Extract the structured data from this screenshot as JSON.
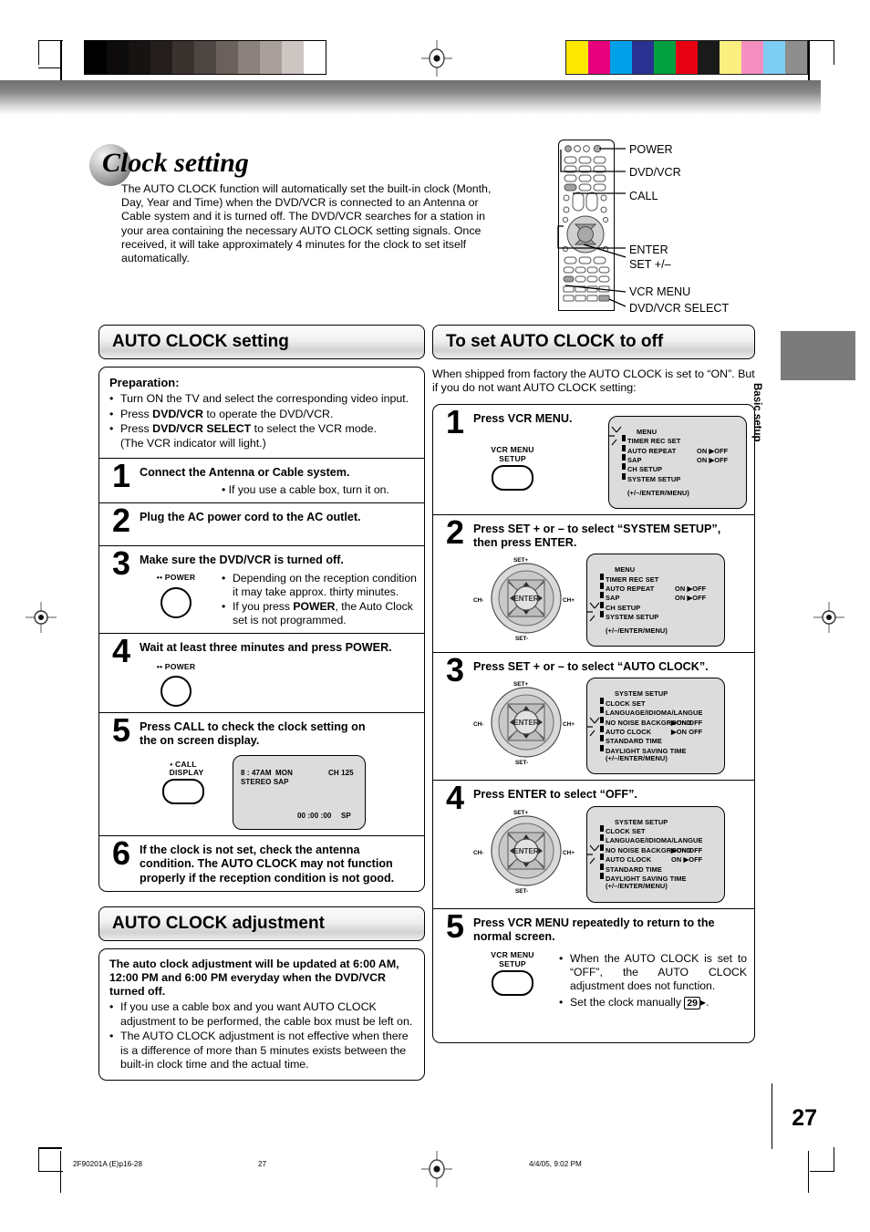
{
  "page": {
    "number": "27",
    "side_tab": "Basic setup"
  },
  "header": {
    "title": "Clock setting",
    "intro": "The AUTO CLOCK function will automatically set the built-in clock (Month, Day, Year and Time) when the DVD/VCR is connected to an Antenna or Cable system and it is turned off. The DVD/VCR searches for a station in your area containing the necessary AUTO CLOCK setting signals. Once received, it will take approximately 4 minutes for the clock to set itself automatically."
  },
  "remote_callouts": [
    "POWER",
    "DVD/VCR",
    "CALL",
    "ENTER",
    "SET +/–",
    "VCR MENU",
    "DVD/VCR SELECT"
  ],
  "left_column": {
    "section_title": "AUTO CLOCK setting",
    "preparation": {
      "heading": "Preparation:",
      "items": [
        "Turn ON the TV and select the corresponding video input.",
        "Press DVD/VCR to operate the DVD/VCR.",
        "Press DVD/VCR SELECT to select the VCR mode. (The VCR indicator will light.)"
      ]
    },
    "steps": [
      {
        "num": "1",
        "title": "Connect the Antenna or Cable system.",
        "bullets": [
          "If you use a cable box, turn it on."
        ]
      },
      {
        "num": "2",
        "title": "Plug the AC power cord to the AC outlet.",
        "bullets": []
      },
      {
        "num": "3",
        "title": "Make sure the DVD/VCR is turned off.",
        "key_label": "POWER",
        "bullets": [
          "Depending on the reception condition it may take approx. thirty minutes.",
          "If you press POWER, the Auto Clock set is not programmed."
        ]
      },
      {
        "num": "4",
        "title": "Wait at least three minutes and press POWER.",
        "key_label": "POWER",
        "bullets": []
      },
      {
        "num": "5",
        "title": "Press CALL to check the clock setting on the on screen display.",
        "key_label_1": "CALL",
        "key_label_2": "DISPLAY",
        "osd": {
          "time": "8 : 47AM",
          "day": "MON",
          "channel": "CH 125",
          "audio": "STEREO SAP",
          "counter": "00 :00 :00",
          "speed": "SP"
        },
        "bullets": []
      },
      {
        "num": "6",
        "title": "If the clock is not set, check the antenna condition. The AUTO CLOCK may not function properly if the reception condition is not good.",
        "bullets": []
      }
    ],
    "adjustment": {
      "section_title": "AUTO CLOCK adjustment",
      "heading": "The auto clock adjustment will be updated at 6:00 AM, 12:00 PM and 6:00 PM everyday when the DVD/VCR turned off.",
      "items": [
        "If you use a cable box and you want AUTO CLOCK adjustment to be performed, the cable box must be left on.",
        "The AUTO CLOCK adjustment is not effective when there is a difference of more than 5 minutes exists between the built-in clock time and the actual time."
      ]
    }
  },
  "right_column": {
    "section_title": "To set AUTO CLOCK to off",
    "intro": "When shipped from factory the AUTO CLOCK is set to “ON”. But if you do not want AUTO CLOCK setting:",
    "steps": [
      {
        "num": "1",
        "title": "Press VCR MENU.",
        "key_label_1": "VCR MENU",
        "key_label_2": "SETUP",
        "osd": {
          "title": "MENU",
          "rows": [
            {
              "label": "TIMER REC SET",
              "values": ""
            },
            {
              "label": "AUTO REPEAT",
              "values": "ON ▶OFF"
            },
            {
              "label": "SAP",
              "values": "ON ▶OFF"
            },
            {
              "label": "CH SETUP",
              "values": ""
            },
            {
              "label": "SYSTEM SETUP",
              "values": ""
            }
          ],
          "footer": "(+/–/ENTER/MENU)",
          "cursor_row": 0
        }
      },
      {
        "num": "2",
        "title": "Press SET + or – to select “SYSTEM SETUP”, then press ENTER.",
        "dpad": {
          "up": "SET+",
          "down": "SET-",
          "left": "CH-",
          "right": "CH+",
          "center": "ENTER"
        },
        "osd": {
          "title": "MENU",
          "rows": [
            {
              "label": "TIMER REC SET",
              "values": ""
            },
            {
              "label": "AUTO REPEAT",
              "values": "ON ▶OFF"
            },
            {
              "label": "SAP",
              "values": "ON ▶OFF"
            },
            {
              "label": "CH SETUP",
              "values": ""
            },
            {
              "label": "SYSTEM SETUP",
              "values": ""
            }
          ],
          "footer": "(+/–/ENTER/MENU)",
          "cursor_row": 4
        }
      },
      {
        "num": "3",
        "title": "Press SET + or – to select “AUTO CLOCK”.",
        "dpad": {
          "up": "SET+",
          "down": "SET-",
          "left": "CH-",
          "right": "CH+",
          "center": "ENTER"
        },
        "osd": {
          "title": "SYSTEM SETUP",
          "rows": [
            {
              "label": "CLOCK SET",
              "values": ""
            },
            {
              "label": "LANGUAGE/IDIOMA/LANGUE",
              "values": ""
            },
            {
              "label": "NO NOISE BACKGROUND",
              "values": "▶ON  OFF"
            },
            {
              "label": "AUTO CLOCK",
              "values": "▶ON  OFF"
            },
            {
              "label": "STANDARD TIME",
              "values": ""
            },
            {
              "label": "DAYLIGHT SAVING TIME",
              "values": ""
            }
          ],
          "footer": "(+/–/ENTER/MENU)",
          "cursor_row": 3
        }
      },
      {
        "num": "4",
        "title": "Press ENTER to select “OFF”.",
        "dpad": {
          "up": "SET+",
          "down": "SET-",
          "left": "CH-",
          "right": "CH+",
          "center": "ENTER"
        },
        "osd": {
          "title": "SYSTEM SETUP",
          "rows": [
            {
              "label": "CLOCK SET",
              "values": ""
            },
            {
              "label": "LANGUAGE/IDIOMA/LANGUE",
              "values": ""
            },
            {
              "label": "NO NOISE BACKGROUND",
              "values": "▶ON  OFF"
            },
            {
              "label": "AUTO CLOCK",
              "values": "ON ▶OFF"
            },
            {
              "label": "STANDARD TIME",
              "values": ""
            },
            {
              "label": "DAYLIGHT SAVING TIME",
              "values": ""
            }
          ],
          "footer": "(+/–/ENTER/MENU)",
          "cursor_row": 3
        }
      },
      {
        "num": "5",
        "title": "Press VCR MENU repeatedly to return to the normal screen.",
        "key_label_1": "VCR MENU",
        "key_label_2": "SETUP",
        "bullets": [
          "When the AUTO CLOCK is set to “OFF”, the AUTO CLOCK adjustment does not function.",
          "Set the clock manually 29."
        ],
        "page_ref": "29"
      }
    ]
  },
  "footer": {
    "doc_code": "2F90201A (E)p16-28",
    "page": "27",
    "timestamp": "4/4/05, 9:02 PM"
  },
  "colors": {
    "tab_gray": "#7b7b7b",
    "osd_bg": "#dcdcdc",
    "swatches": [
      "#ffe800",
      "#e6007e",
      "#00a0e9",
      "#2b3190",
      "#00a040",
      "#e60012",
      "#1a1a1a",
      "#faef7f",
      "#f48fc0",
      "#7ecef4",
      "#8e8e8e"
    ]
  }
}
